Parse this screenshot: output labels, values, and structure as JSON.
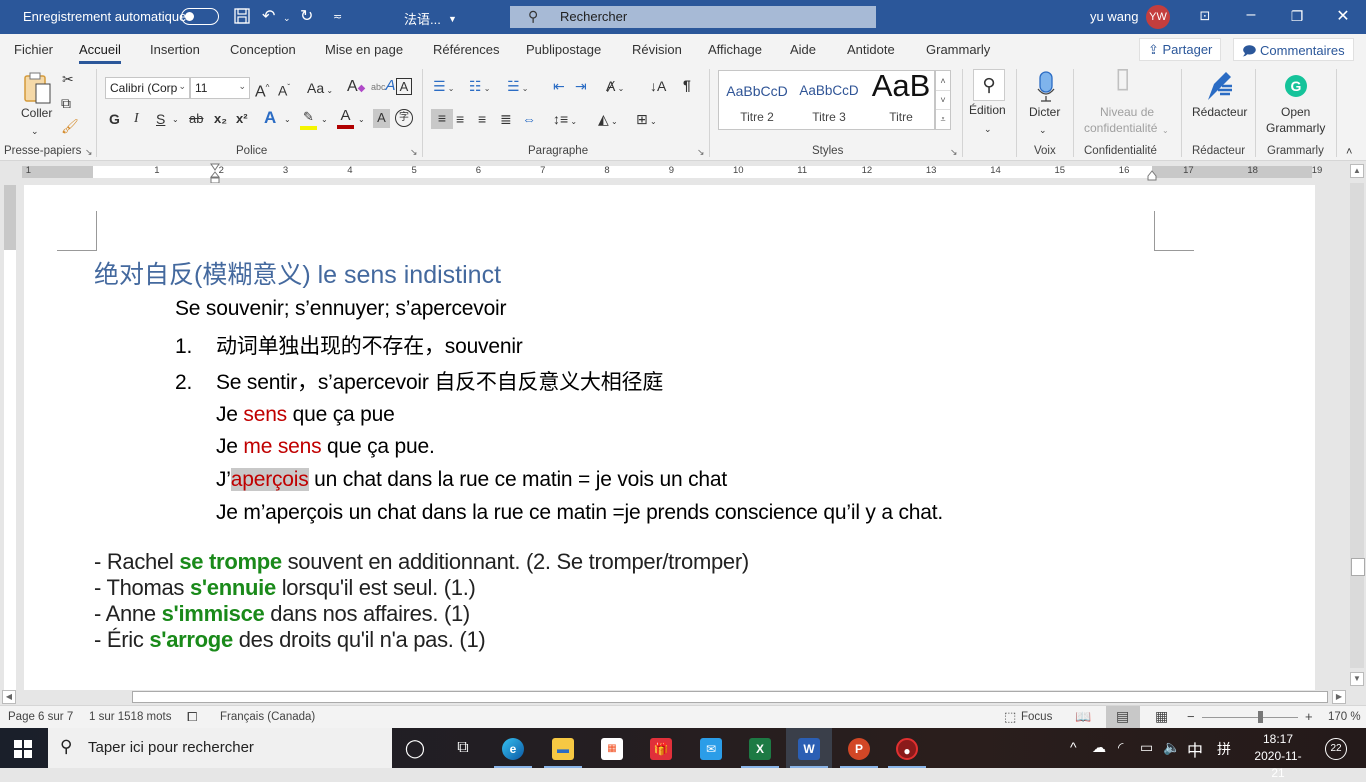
{
  "titlebar": {
    "autosave_label": "Enregistrement automatique",
    "autosave_on": false,
    "doc_name": "法语...",
    "search_placeholder": "Rechercher",
    "user_name": "yu wang",
    "user_initials": "YW",
    "icons": {
      "save": "save-icon",
      "undo": "undo-icon",
      "redo": "redo-icon",
      "customize": "customize-qat-icon"
    }
  },
  "tabs": {
    "items": [
      "Fichier",
      "Accueil",
      "Insertion",
      "Conception",
      "Mise en page",
      "Références",
      "Publipostage",
      "Révision",
      "Affichage",
      "Aide",
      "Antidote",
      "Grammarly"
    ],
    "active": "Accueil",
    "share_label": "Partager",
    "comments_label": "Commentaires"
  },
  "ribbon": {
    "clipboard": {
      "paste_label": "Coller",
      "group_label": "Presse-papiers"
    },
    "font": {
      "font_name": "Calibri (Corp",
      "font_size": "11",
      "group_label": "Police",
      "bold": "G",
      "italic": "I",
      "underline": "S",
      "strike": "ab",
      "subscript": "x₂",
      "superscript": "x²",
      "change_case": "Aa"
    },
    "paragraph": {
      "group_label": "Paragraphe"
    },
    "styles": {
      "group_label": "Styles",
      "items": [
        {
          "preview": "AaBbCcD",
          "name": "Titre 2"
        },
        {
          "preview": "AaBbCcD",
          "name": "Titre 3"
        },
        {
          "preview": "AaB",
          "name": "Titre"
        }
      ]
    },
    "editing": {
      "label": "Édition"
    },
    "voice": {
      "label": "Dicter",
      "group_label": "Voix"
    },
    "sensitivity": {
      "label_line1": "Niveau de",
      "label_line2": "confidentialité",
      "group_label": "Confidentialité"
    },
    "editor": {
      "label": "Rédacteur",
      "group_label": "Rédacteur"
    },
    "grammarly": {
      "label_line1": "Open",
      "label_line2": "Grammarly",
      "group_label": "Grammarly"
    }
  },
  "ruler": {
    "numbers": [
      "1",
      "1",
      "2",
      "3",
      "4",
      "5",
      "6",
      "7",
      "8",
      "9",
      "10",
      "11",
      "12",
      "13",
      "14",
      "15",
      "16",
      "17",
      "18",
      "19"
    ]
  },
  "document": {
    "heading": "绝对自反(模糊意义) le sens indistinct",
    "line_verbs": "Se souvenir; s’ennuyer; s’apercevoir",
    "list": [
      {
        "num": "1.",
        "text": "动词单独出现的不存在，souvenir"
      },
      {
        "num": "2.",
        "text": "Se sentir，s’apercevoir 自反不自反意义大相径庭"
      }
    ],
    "examples": [
      {
        "pre": "Je ",
        "red": "sens",
        "post": " que ça pue"
      },
      {
        "pre": "Je ",
        "red": "me sens",
        "post": " que ça pue."
      },
      {
        "pre": "J’",
        "red": "aperçois",
        "post": " un chat dans la rue ce matin = je vois un chat"
      },
      {
        "pre": "Je m’aperçois un chat dans la rue ce matin =je prends conscience qu’il y a chat.",
        "red": "",
        "post": ""
      }
    ],
    "sentences": [
      {
        "pre": "- Rachel ",
        "verb": "se trompe",
        "post": " souvent en additionnant. (2. Se tromper/tromper)"
      },
      {
        "pre": "- Thomas ",
        "verb": "s'ennuie",
        "post": " lorsqu'il est seul.  (1.)"
      },
      {
        "pre": "- Anne ",
        "verb": "s'immisce",
        "post": " dans nos affaires.  (1)"
      },
      {
        "pre": "- Éric ",
        "verb": "s'arroge",
        "post": " des droits qu'il n'a pas. (1)"
      }
    ],
    "colors": {
      "heading": "#44699e",
      "red": "#c00000",
      "green": "#1a8a1a",
      "highlight": "#c8c8c8"
    }
  },
  "status": {
    "page": "Page 6 sur 7",
    "words": "1 sur 1518 mots",
    "language": "Français (Canada)",
    "focus_label": "Focus",
    "zoom_minus": "−",
    "zoom_plus": "+",
    "zoom_level": "170 %",
    "zoom_percent": 170
  },
  "taskbar": {
    "search_placeholder": "Taper ici pour rechercher",
    "time": "18:17",
    "date": "2020-11-21",
    "ime_lang": "中",
    "ime_mode": "拼",
    "notifications": "22",
    "apps": [
      "Cortana",
      "Task View",
      "Edge",
      "Explorateur de fichiers",
      "Microsoft Store",
      "Cadeau",
      "Courrier",
      "Excel",
      "Word",
      "PowerPoint",
      "Enregistreur"
    ]
  }
}
